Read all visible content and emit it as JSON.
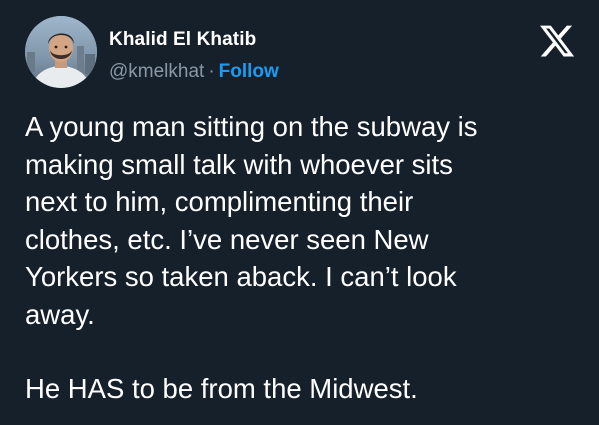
{
  "colors": {
    "background": "#15202b",
    "text_primary": "#ffffff",
    "text_secondary": "#8b98a5",
    "link_blue": "#1d9bf0"
  },
  "author": {
    "display_name": "Khalid El Khatib",
    "handle": "@kmelkhat",
    "separator": "·",
    "follow_label": "Follow",
    "avatar_icon": "profile-photo"
  },
  "platform": {
    "logo_icon": "x-logo"
  },
  "tweet": {
    "lines": [
      "A young man sitting on the subway is",
      "making small talk with whoever sits",
      "next to him, complimenting their",
      "clothes, etc. I’ve never seen New",
      "Yorkers so taken aback. I can’t look",
      "away."
    ],
    "last_paragraph": "He HAS to be from the Midwest."
  }
}
